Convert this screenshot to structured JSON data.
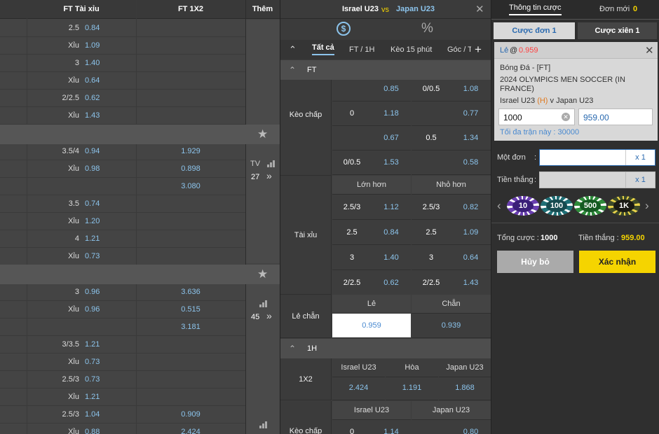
{
  "left": {
    "headers": {
      "ou": "FT Tài xỉu",
      "x12": "FT 1X2",
      "more": "Thêm"
    },
    "rows_a": [
      {
        "label": "2.5",
        "odd": "0.84",
        "x12": ""
      },
      {
        "label": "Xỉu",
        "odd": "1.09",
        "x12": ""
      },
      {
        "label": "3",
        "odd": "1.40",
        "x12": ""
      },
      {
        "label": "Xỉu",
        "odd": "0.64",
        "x12": ""
      },
      {
        "label": "2/2.5",
        "odd": "0.62",
        "x12": ""
      },
      {
        "label": "Xỉu",
        "odd": "1.43",
        "x12": ""
      }
    ],
    "rows_b": [
      {
        "label": "3.5/4",
        "odd": "0.94",
        "x12": "1.929"
      },
      {
        "label": "Xỉu",
        "odd": "0.98",
        "x12": "0.898"
      },
      {
        "label": "",
        "odd": "",
        "x12": "3.080"
      },
      {
        "label": "3.5",
        "odd": "0.74",
        "x12": ""
      },
      {
        "label": "Xỉu",
        "odd": "1.20",
        "x12": ""
      },
      {
        "label": "4",
        "odd": "1.21",
        "x12": ""
      },
      {
        "label": "Xỉu",
        "odd": "0.73",
        "x12": ""
      }
    ],
    "rows_c": [
      {
        "label": "3",
        "odd": "0.96",
        "x12": "3.636"
      },
      {
        "label": "Xỉu",
        "odd": "0.96",
        "x12": "0.515"
      },
      {
        "label": "",
        "odd": "",
        "x12": "3.181"
      },
      {
        "label": "3/3.5",
        "odd": "1.21",
        "x12": ""
      },
      {
        "label": "Xỉu",
        "odd": "0.73",
        "x12": ""
      },
      {
        "label": "2.5/3",
        "odd": "0.73",
        "x12": ""
      },
      {
        "label": "Xỉu",
        "odd": "1.21",
        "x12": ""
      },
      {
        "label": "2.5/3",
        "odd": "1.04",
        "x12": "0.909"
      },
      {
        "label": "Xỉu",
        "odd": "0.88",
        "x12": "2.424"
      }
    ],
    "match_b": {
      "tv": "TV",
      "count": "27",
      "more": "»"
    },
    "match_c": {
      "count": "45",
      "more": "»"
    },
    "star": "★"
  },
  "mid": {
    "home": "Israel U23",
    "vs": "vs",
    "away": "Japan U23",
    "close": "✕",
    "money_icon": "$",
    "percent_icon": "%",
    "collapse": "⌃",
    "tabs": [
      "Tất cả",
      "FT / 1H",
      "Kèo 15 phút",
      "Góc / T"
    ],
    "add": "+",
    "sec_ft": "FT",
    "sec_1h": "1H",
    "hdp_label": "Kèo chấp",
    "hdp": [
      {
        "l": "",
        "lo": "0.85",
        "r": "0/0.5",
        "ro": "1.08"
      },
      {
        "l": "0",
        "lo": "1.18",
        "r": "",
        "ro": "0.77"
      },
      {
        "l": "",
        "lo": "0.67",
        "r": "0.5",
        "ro": "1.34"
      },
      {
        "l": "0/0.5",
        "lo": "1.53",
        "r": "",
        "ro": "0.58"
      }
    ],
    "ou_label": "Tài xỉu",
    "ou_over": "Lớn hơn",
    "ou_under": "Nhỏ hơn",
    "ou": [
      {
        "l": "2.5/3",
        "lo": "1.12",
        "r": "2.5/3",
        "ro": "0.82"
      },
      {
        "l": "2.5",
        "lo": "0.84",
        "r": "2.5",
        "ro": "1.09"
      },
      {
        "l": "3",
        "lo": "1.40",
        "r": "3",
        "ro": "0.64"
      },
      {
        "l": "2/2.5",
        "lo": "0.62",
        "r": "2/2.5",
        "ro": "1.43"
      }
    ],
    "oe_label": "Lẻ chẵn",
    "oe_odd": "Lẻ",
    "oe_even": "Chẵn",
    "oe_odd_val": "0.959",
    "oe_even_val": "0.939",
    "x12_label": "1X2",
    "x12_home": "Israel U23",
    "x12_draw": "Hòa",
    "x12_away": "Japan U23",
    "x12_vals": [
      "2.424",
      "1.191",
      "1.868"
    ],
    "h1_home": "Israel U23",
    "h1_away": "Japan U23",
    "h1_label": "Kèo chấp",
    "h1_row": {
      "l": "0",
      "lo": "1.14",
      "ro": "0.80"
    }
  },
  "right": {
    "tab_info": "Thông tin cược",
    "tab_new": "Đơn mới",
    "new_count": "0",
    "single": "Cược đơn 1",
    "parlay": "Cược xiên 1",
    "sel_label": "Lẻ",
    "sel_at": "@",
    "sel_odd": "0.959",
    "sport": "Bóng Đá - [FT]",
    "league": "2024 OLYMPICS MEN SOCCER (IN FRANCE)",
    "home": "Israel U23",
    "home_tag": "(H)",
    "v": "v",
    "away": "Japan U23",
    "stake": "1000",
    "payout": "959.00",
    "max_label": "Tối đa trận này : 30000",
    "single_label": "Một đơn",
    "colon": ":",
    "x1": "x 1",
    "win_label": "Tiền thắng",
    "chips": [
      "10",
      "100",
      "500",
      "1K"
    ],
    "total_label": "Tổng cược :",
    "total_val": "1000",
    "win_total_label": "Tiền thắng :",
    "win_total_val": "959.00",
    "cancel": "Hủy bỏ",
    "confirm": "Xác nhận",
    "colors": {
      "accent": "#f5d400",
      "odd": "#8cc4ec",
      "red": "#ff4040"
    }
  }
}
